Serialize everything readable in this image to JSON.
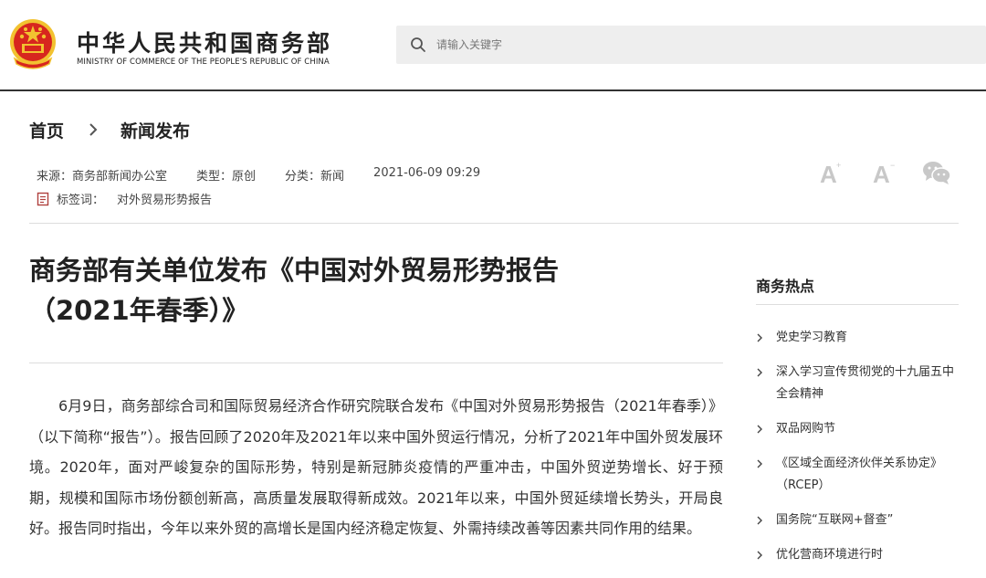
{
  "header": {
    "site_title": "中华人民共和国商务部",
    "site_subtitle": "MINISTRY OF COMMERCE OF THE PEOPLE'S REPUBLIC OF CHINA",
    "search_placeholder": "请输入关键字",
    "emblem_icon": "national-emblem-icon",
    "search_icon": "search-icon"
  },
  "breadcrumb": {
    "home": "首页",
    "current": "新闻发布"
  },
  "meta": {
    "source": "来源：商务部新闻办公室",
    "type": "类型：原创",
    "category": "分类：新闻",
    "datetime": "2021-06-09 09:29",
    "tag_label": "标签词：",
    "tag_value": "对外贸易形势报告"
  },
  "tools": {
    "font_large_icon": "font-increase-icon",
    "font_small_icon": "font-decrease-icon",
    "share_icon": "wechat-icon"
  },
  "article": {
    "title_line1": "商务部有关单位发布《中国对外贸易形势报告",
    "title_line2": "（2021年春季）》",
    "body": "6月9日，商务部综合司和国际贸易经济合作研究院联合发布《中国对外贸易形势报告（2021年春季）》（以下简称“报告”）。报告回顾了2020年及2021年以来中国外贸运行情况，分析了2021年中国外贸发展环境。2020年，面对严峻复杂的国际形势，特别是新冠肺炎疫情的严重冲击，中国外贸逆势增长、好于预期，规模和国际市场份额创新高，高质量发展取得新成效。2021年以来，中国外贸延续增长势头，开局良好。报告同时指出，今年以来外贸的高增长是国内经济稳定恢复、外需持续改善等因素共同作用的结果。"
  },
  "sidebar": {
    "title": "商务热点",
    "items": [
      {
        "label": "党史学习教育"
      },
      {
        "label": "深入学习宣传贯彻党的十九届五中全会精神"
      },
      {
        "label": "双品网购节"
      },
      {
        "label": "《区域全面经济伙伴关系协定》（RCEP）"
      },
      {
        "label": "国务院“互联网+督查”"
      },
      {
        "label": "优化营商环境进行时"
      }
    ]
  },
  "colors": {
    "emblem_red": "#d7261e",
    "emblem_gold": "#f2c230",
    "search_bg": "#eeeeee",
    "header_rule": "#333333"
  }
}
